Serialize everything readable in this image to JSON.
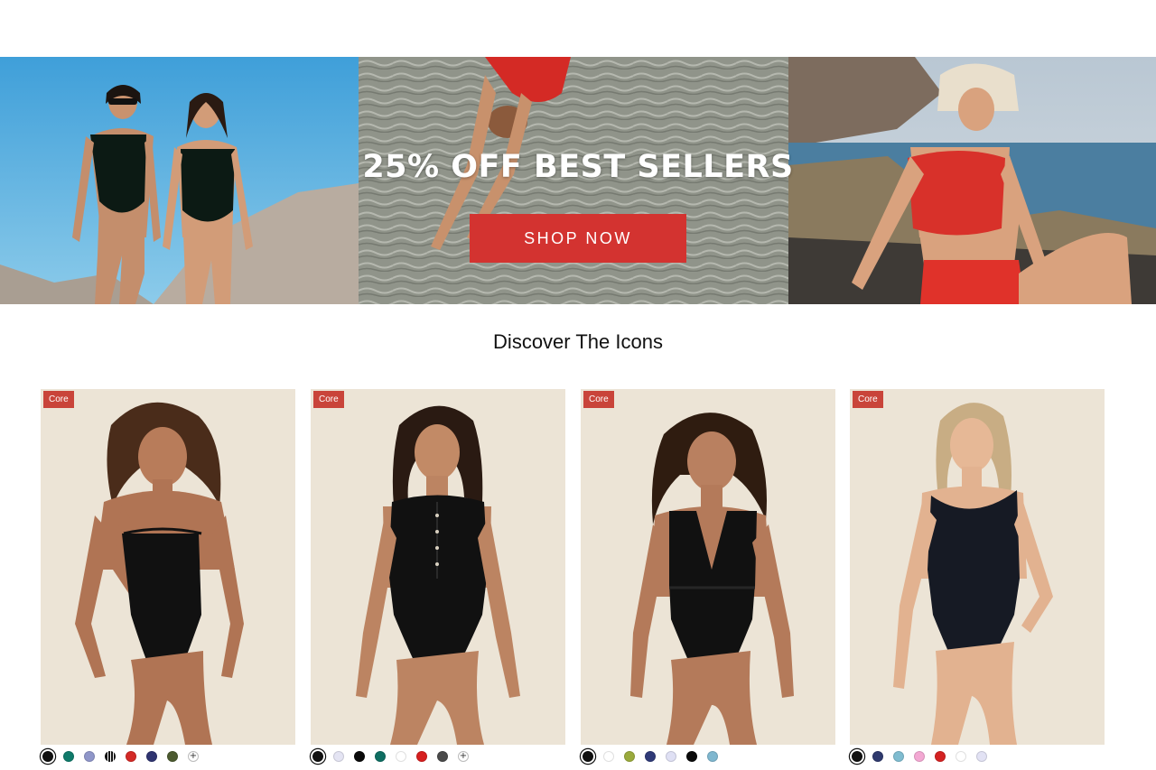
{
  "hero": {
    "headline": "25% OFF BEST SELLERS",
    "cta_label": "SHOP NOW"
  },
  "section_title": "Discover The Icons",
  "products": [
    {
      "badge": "Core",
      "swatches": [
        "#111111",
        "#0f7a6a",
        "#8f96c9",
        "striped",
        "#d32a26",
        "#2f3470",
        "#4c5a2f",
        "plus"
      ]
    },
    {
      "badge": "Core",
      "swatches": [
        "#111111",
        "#e4e4f3",
        "#0a0a0a",
        "#0f6e62",
        "#ffffff",
        "#d61f1f",
        "#4a4a4a",
        "plus"
      ]
    },
    {
      "badge": "Core",
      "swatches": [
        "#111111",
        "#ffffff",
        "#9aaa3c",
        "#2f3a78",
        "#dfe0f4",
        "#0a0a0a",
        "#7fb7cf"
      ]
    },
    {
      "badge": "Core",
      "swatches": [
        "#111111",
        "#2f3a6e",
        "#7fbcd0",
        "#f3a8d3",
        "#d42222",
        "#ffffff",
        "#e2e2f4"
      ]
    }
  ],
  "colors": {
    "cta_red": "#d33330",
    "badge_red": "#c9443a",
    "card_bg": "#ece4d6"
  }
}
